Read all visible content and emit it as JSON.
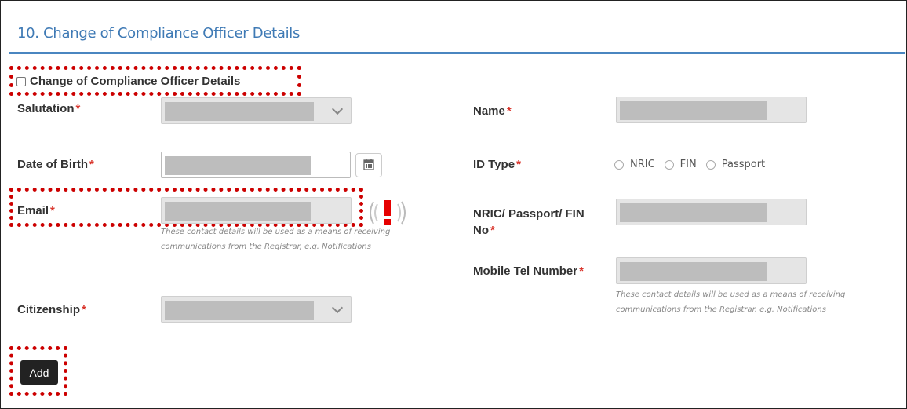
{
  "section": {
    "title": "10. Change of Compliance Officer Details"
  },
  "checkbox": {
    "label": "Change of Compliance Officer Details",
    "checked": false
  },
  "fields": {
    "salutation": {
      "label": "Salutation",
      "required": "*"
    },
    "date_of_birth": {
      "label": "Date of Birth",
      "required": "*"
    },
    "email": {
      "label": "Email",
      "required": "*"
    },
    "citizenship": {
      "label": "Citizenship",
      "required": "*"
    },
    "name": {
      "label": "Name",
      "required": "*"
    },
    "id_type": {
      "label": "ID Type",
      "required": "*",
      "options": [
        "NRIC",
        "FIN",
        "Passport"
      ]
    },
    "id_number": {
      "label_line1": "NRIC/ Passport/ FIN",
      "label_line2": "No",
      "required": "*"
    },
    "mobile": {
      "label": "Mobile Tel Number",
      "required": "*"
    }
  },
  "notes": {
    "email_note": "These contact details will be used as a means of receiving communications from the Registrar, e.g. Notifications",
    "mobile_note": "These contact details will be used as a means of receiving communications from the Registrar, e.g. Notifications"
  },
  "buttons": {
    "add": "Add"
  },
  "icons": {
    "calendar": "calendar-icon",
    "dropdown": "chevron-down-icon",
    "alert": "alert-icon"
  },
  "colors": {
    "title": "#3f7ab5",
    "rule": "#4a86c0",
    "required": "#d9342b",
    "highlight": "#cc0000",
    "button": "#222222"
  }
}
